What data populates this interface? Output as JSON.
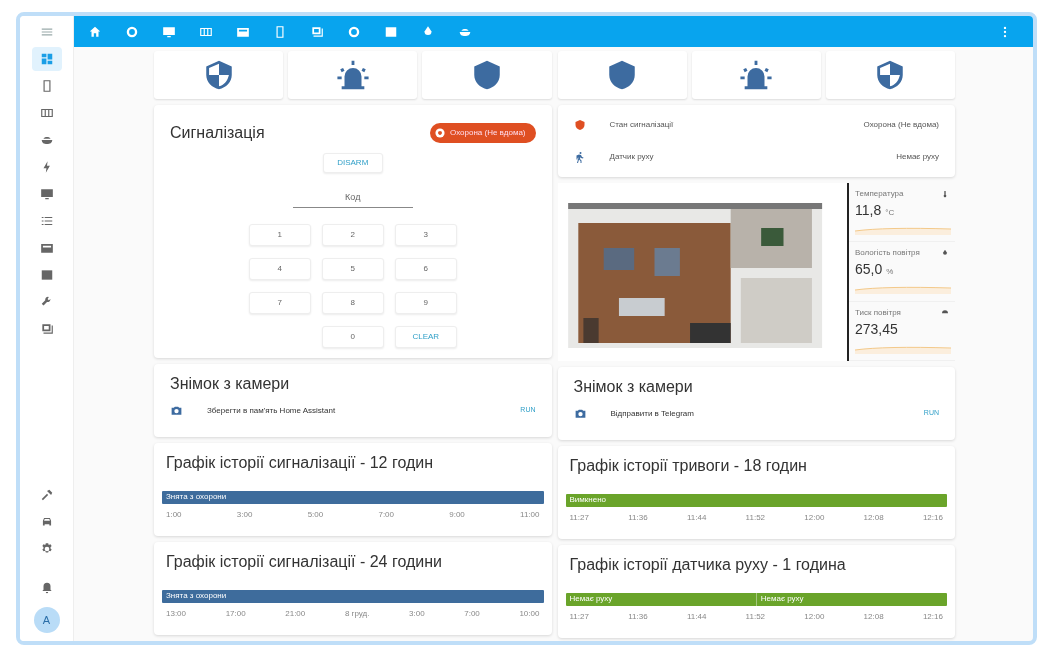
{
  "sidebar": {
    "items": [
      {
        "selected": true
      },
      {
        "selected": false
      },
      {
        "selected": false
      },
      {
        "selected": false
      },
      {
        "selected": false
      },
      {
        "selected": false
      },
      {
        "selected": false
      },
      {
        "selected": false
      },
      {
        "selected": false
      },
      {
        "selected": false
      },
      {
        "selected": false
      }
    ]
  },
  "user": {
    "initial": "A"
  },
  "alarm_panel": {
    "title": "Сигналізація",
    "state_badge": "Охорона (Не вдома)",
    "disarm_button": "DISARM",
    "placeholder": "Код",
    "keys": [
      {
        "label": "1",
        "kind": "digit"
      },
      {
        "label": "2",
        "kind": "digit"
      },
      {
        "label": "3",
        "kind": "digit"
      },
      {
        "label": "4",
        "kind": "digit"
      },
      {
        "label": "5",
        "kind": "digit"
      },
      {
        "label": "6",
        "kind": "digit"
      },
      {
        "label": "7",
        "kind": "digit"
      },
      {
        "label": "8",
        "kind": "digit"
      },
      {
        "label": "9",
        "kind": "digit"
      },
      {
        "label": "0",
        "kind": "digit"
      },
      {
        "label": "CLEAR",
        "kind": "action"
      }
    ]
  },
  "entities": [
    {
      "kind": "alarm",
      "name": "Стан сигналізації",
      "state": "Охорона (Не вдома)"
    },
    {
      "kind": "motion",
      "name": "Датчик руху",
      "state": "Немає руху"
    }
  ],
  "sensors": [
    {
      "name": "Температура",
      "value": "11,8",
      "unit": "°C"
    },
    {
      "name": "Вологість повітря",
      "value": "65,0",
      "unit": "%"
    },
    {
      "name": "Тиск повітря",
      "value": "273,45"
    }
  ],
  "cameras": [
    {
      "title": "Знімок з камери",
      "action": "Зберегти в пам'ять Home Assistant",
      "button": "RUN"
    },
    {
      "title": "Знімок з камери",
      "action": "Відправити в Telegram",
      "button": "RUN"
    }
  ],
  "history_left": [
    {
      "title": "Графік історії сигналізації - 12 годин",
      "color": "#3e6c9c",
      "segments": [
        {
          "label": "Знята з охорони"
        }
      ],
      "ticks": [
        "1:00",
        "3:00",
        "5:00",
        "7:00",
        "9:00",
        "11:00"
      ]
    },
    {
      "title": "Графік історії сигналізації - 24 години",
      "color": "#3e6c9c",
      "segments": [
        {
          "label": "Знята з охорони"
        }
      ],
      "ticks": [
        "13:00",
        "17:00",
        "21:00",
        "8 груд.",
        "3:00",
        "7:00",
        "10:00"
      ]
    }
  ],
  "history_right": [
    {
      "title": "Графік історії тривоги - 18 годин",
      "color": "#6aa42a",
      "segments": [
        {
          "label": "Вимкнено"
        }
      ],
      "ticks": [
        "11:27",
        "11:36",
        "11:44",
        "11:52",
        "12:00",
        "12:08",
        "12:16"
      ]
    },
    {
      "title": "Графік історії датчика руху - 1 година",
      "color": "#6aa42a",
      "segments": [
        {
          "label": "Немає руху"
        },
        {
          "label": "Немає руху"
        }
      ],
      "ticks": [
        "11:27",
        "11:36",
        "11:44",
        "11:52",
        "12:00",
        "12:08",
        "12:16"
      ]
    }
  ]
}
